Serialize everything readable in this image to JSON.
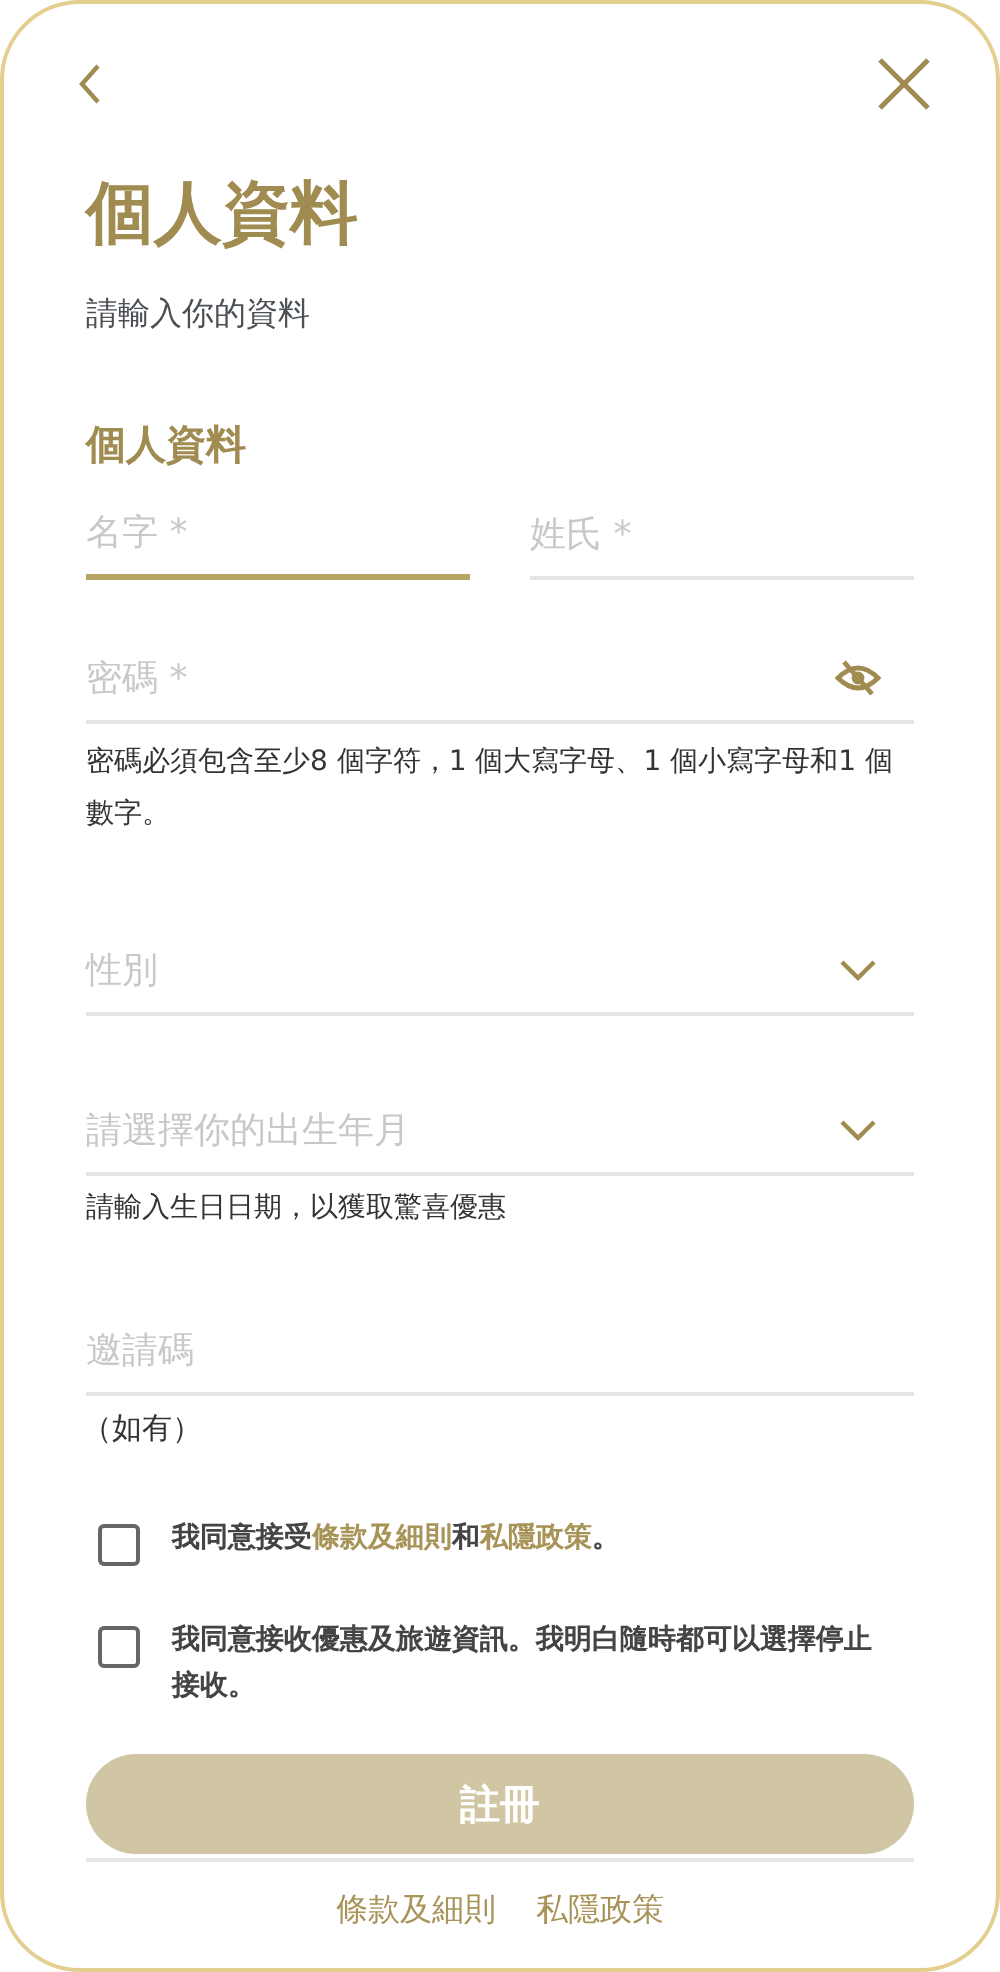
{
  "title": "個人資料",
  "subtitle": "請輸入你的資料",
  "section_heading": "個人資料",
  "name_fields": [
    {
      "placeholder": "名字 *",
      "focused": true
    },
    {
      "placeholder": "姓氏 *",
      "focused": false
    }
  ],
  "fields": [
    {
      "kind": "password",
      "placeholder": "密碼 *",
      "hint": "密碼必須包含至少8 個字符，1 個大寫字母、1 個小寫字母和1 個數字。"
    },
    {
      "kind": "select",
      "placeholder": "性別"
    },
    {
      "kind": "select",
      "placeholder": "請選擇你的出生年月",
      "hint": "請輸入生日日期，以獲取驚喜優惠"
    },
    {
      "kind": "text",
      "placeholder": "邀請碼",
      "hint": "（如有）"
    }
  ],
  "consents": [
    {
      "checked": false,
      "parts": [
        {
          "kind": "text",
          "text": "我同意接受"
        },
        {
          "kind": "link",
          "text": "條款及細則"
        },
        {
          "kind": "text",
          "text": "和"
        },
        {
          "kind": "link",
          "text": "私隱政策"
        },
        {
          "kind": "text",
          "text": "。"
        }
      ]
    },
    {
      "checked": false,
      "parts": [
        {
          "kind": "text",
          "text": "我同意接收優惠及旅遊資訊。我明白隨時都可以選擇停止接收。"
        }
      ]
    }
  ],
  "submit": {
    "label": "註冊",
    "disabled": true
  },
  "footer_links": [
    "條款及細則",
    "私隱政策"
  ]
}
